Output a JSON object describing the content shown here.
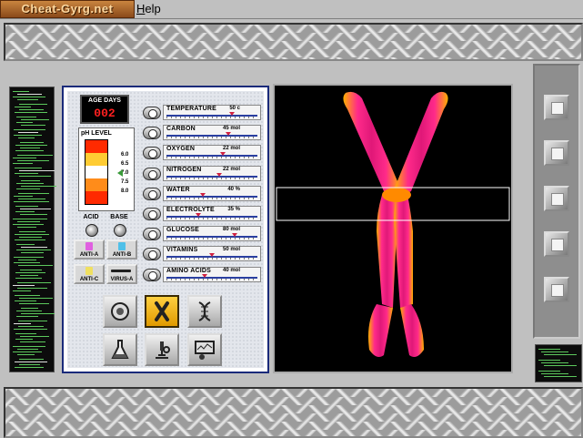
{
  "menubar": {
    "logo_text": "Cheat-Gyrg.net",
    "help_first": "H",
    "help_rest": "elp"
  },
  "age": {
    "label": "AGE DAYS",
    "value": "002"
  },
  "ph": {
    "label": "pH LEVEL",
    "scale": [
      "6.0",
      "6.5",
      "7.0",
      "7.5",
      "8.0"
    ],
    "current": "7.0",
    "acid_label": "ACID",
    "base_label": "BASE",
    "colors": [
      "#ff2a00",
      "#ffcc33",
      "#ffffff",
      "#ff8c1a",
      "#ff2a00"
    ]
  },
  "antibodies": [
    {
      "label": "ANTI-A",
      "color": "#e060e0"
    },
    {
      "label": "ANTI-B",
      "color": "#50c0e8"
    },
    {
      "label": "ANTI-C",
      "color": "#f0e060"
    },
    {
      "label": "VIRUS-A",
      "color": "#202020"
    }
  ],
  "gauges": [
    {
      "name": "TEMPERATURE",
      "value": "50 c",
      "level": 0.72
    },
    {
      "name": "CARBON",
      "value": "45 mol",
      "level": 0.68
    },
    {
      "name": "OXYGEN",
      "value": "22 mol",
      "level": 0.62
    },
    {
      "name": "NITROGEN",
      "value": "22 mol",
      "level": 0.58
    },
    {
      "name": "WATER",
      "value": "40 %",
      "level": 0.4
    },
    {
      "name": "ELECTROLYTE",
      "value": "35 %",
      "level": 0.35
    },
    {
      "name": "GLUCOSE",
      "value": "80 mol",
      "level": 0.75
    },
    {
      "name": "VITAMINS",
      "value": "50 mol",
      "level": 0.5
    },
    {
      "name": "AMINO ACIDS",
      "value": "40 mol",
      "level": 0.42
    }
  ],
  "tools": [
    {
      "name": "cell-view",
      "active": false
    },
    {
      "name": "chromosome-view",
      "active": true
    },
    {
      "name": "dna-view",
      "active": false
    },
    {
      "name": "chemistry-flask",
      "active": false
    },
    {
      "name": "microscope",
      "active": false
    },
    {
      "name": "monitor",
      "active": false
    }
  ],
  "viewer": {
    "subject": "chromosome",
    "scan_highlight": true
  }
}
